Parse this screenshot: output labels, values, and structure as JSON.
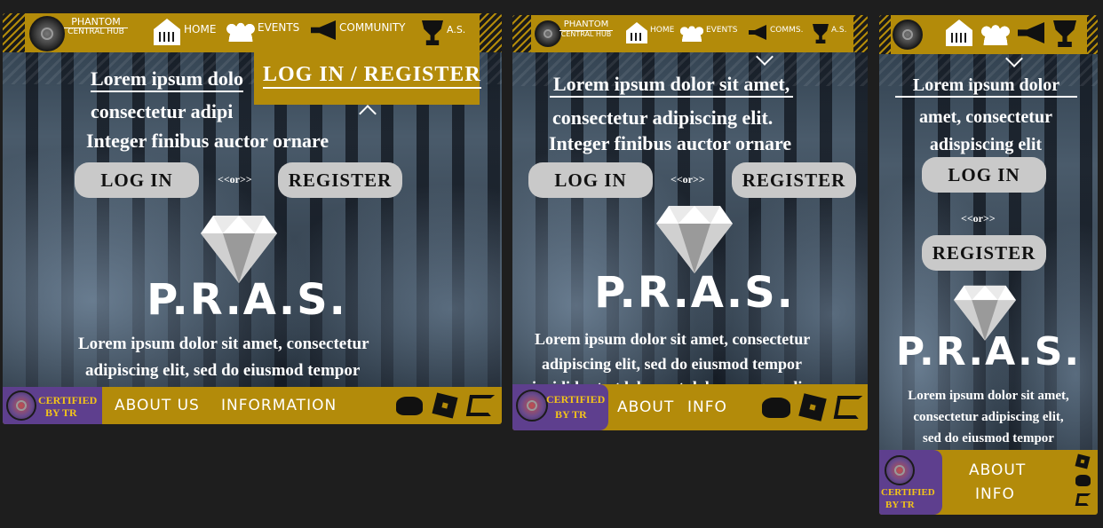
{
  "brand": {
    "line1": "PHANTOM",
    "line2": "CENTRAL HUB"
  },
  "nav": {
    "home": "HOME",
    "events": "EVENTS",
    "community": "COMMUNITY",
    "community_short": "COMMS.",
    "as": "A.S."
  },
  "dropdown": {
    "login_register": "LOG IN / REGISTER"
  },
  "hero": {
    "heading_desktop_line1": "Lorem ipsum dolo",
    "heading_desktop_line2": "consectetur adipi",
    "heading_tablet_line1": "Lorem ipsum dolor sit amet,",
    "heading_tablet_line2": "consectetur adipiscing elit.",
    "heading_line3": "Integer finibus auctor ornare",
    "heading_mobile_line1": "Lorem ipsum dolor",
    "heading_mobile_line2": "amet, consectetur",
    "heading_mobile_line3": "adispiscing elit"
  },
  "buttons": {
    "login": "LOG IN",
    "register": "REGISTER",
    "or": "<<or>>"
  },
  "pras": "P.R.A.S.",
  "body_text": {
    "desktop_line1": "Lorem ipsum dolor sit amet, consectetur",
    "desktop_line2": "adipiscing elit, sed do eiusmod tempor",
    "tablet_line1": "Lorem ipsum dolor sit amet, consectetur",
    "tablet_line2": "adipiscing elit, sed do eiusmod tempor",
    "tablet_line3": "incididunt ut labore et dolore magna aliqua",
    "mobile_line1": "Lorem ipsum dolor sit amet,",
    "mobile_line2": "consectetur adipiscing elit,",
    "mobile_line3": "sed do eiusmod tempor"
  },
  "footer": {
    "cert_line1": "CERTIFIED",
    "cert_line2": "BY TR",
    "about": "ABOUT US",
    "information": "INFORMATION",
    "about_short": "ABOUT",
    "info_short": "INFO"
  },
  "icons": [
    "house-icon",
    "crowd-icon",
    "megaphone-icon",
    "trophy-icon",
    "discord-icon",
    "roblox-icon",
    "guilded-icon",
    "chevron-down-icon",
    "chevron-up-icon",
    "diamond-icon"
  ],
  "colors": {
    "gold": "#b38b0a",
    "purple": "#5e3f8e",
    "cert_text": "#f3c419",
    "button": "#c9c9c9",
    "page_bg": "#1e1e1e"
  }
}
